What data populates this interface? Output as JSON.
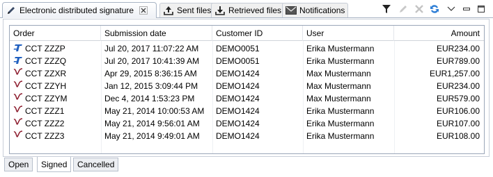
{
  "tabs": [
    {
      "label": "Electronic distributed signature",
      "icon": "pencil-icon",
      "active": true
    },
    {
      "label": "Sent files",
      "icon": "upload-icon"
    },
    {
      "label": "Retrieved files",
      "icon": "download-icon"
    },
    {
      "label": "Notifications",
      "icon": "envelope-icon"
    }
  ],
  "toolbar": [
    "filter-icon",
    "edit-icon",
    "delete-icon",
    "refresh-icon",
    "view-menu-icon",
    "minimize-icon",
    "maximize-icon"
  ],
  "table": {
    "columns": [
      "Order",
      "Submission date",
      "Customer ID",
      "User",
      "Amount"
    ],
    "rows": [
      {
        "icon": "bank-t-icon",
        "order": "CCT ZZZP",
        "date": "Jul 20, 2017 11:07:22 AM",
        "customer": "DEMO0051",
        "user": "Erika Mustermann",
        "amount": "EUR234.00"
      },
      {
        "icon": "bank-t-icon",
        "order": "CCT ZZZQ",
        "date": "Jul 20, 2017 10:41:39 AM",
        "customer": "DEMO0051",
        "user": "Erika Mustermann",
        "amount": "EUR789.00"
      },
      {
        "icon": "signature-icon",
        "order": "CCT ZZXR",
        "date": "Apr 29, 2015 8:36:15 AM",
        "customer": "DEMO1424",
        "user": "Max Mustermann",
        "amount": "EUR1,257.00"
      },
      {
        "icon": "signature-icon",
        "order": "CCT ZZYH",
        "date": "Jan 12, 2015 3:09:44 PM",
        "customer": "DEMO1424",
        "user": "Max Mustermann",
        "amount": "EUR234.00"
      },
      {
        "icon": "signature-icon",
        "order": "CCT ZZYM",
        "date": "Dec 4, 2014 1:53:23 PM",
        "customer": "DEMO1424",
        "user": "Max Mustermann",
        "amount": "EUR579.00"
      },
      {
        "icon": "signature-icon",
        "order": "CCT ZZZ1",
        "date": "May 21, 2014 10:00:53 AM",
        "customer": "DEMO1424",
        "user": "Erika Mustermann",
        "amount": "EUR106.00"
      },
      {
        "icon": "signature-icon",
        "order": "CCT ZZZ2",
        "date": "May 21, 2014 9:56:01 AM",
        "customer": "DEMO1424",
        "user": "Erika Mustermann",
        "amount": "EUR107.00"
      },
      {
        "icon": "signature-icon",
        "order": "CCT ZZZ3",
        "date": "May 21, 2014 9:49:01 AM",
        "customer": "DEMO1424",
        "user": "Erika Mustermann",
        "amount": "EUR108.00"
      }
    ]
  },
  "bottom_tabs": [
    "Open",
    "Signed",
    "Cancelled"
  ],
  "selected_bottom_tab": "Signed",
  "colors": {
    "accent_blue": "#1f5fbf",
    "signature_red": "#8b1a2b",
    "refresh_blue": "#2f7fd6"
  }
}
